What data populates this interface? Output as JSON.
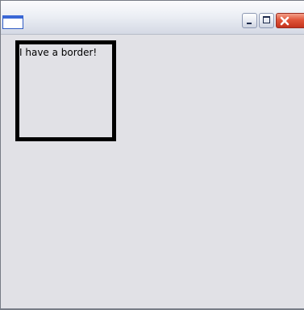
{
  "window": {
    "title": "",
    "icons": {
      "app": "window-app-icon",
      "minimize": "minimize-icon",
      "maximize": "maximize-icon",
      "close": "close-icon"
    },
    "colors": {
      "background": "#e1e1e6",
      "close_button": "#d9442b",
      "border_box": "#000000"
    }
  },
  "content": {
    "bordered_box": {
      "text": "I have a border!"
    }
  }
}
